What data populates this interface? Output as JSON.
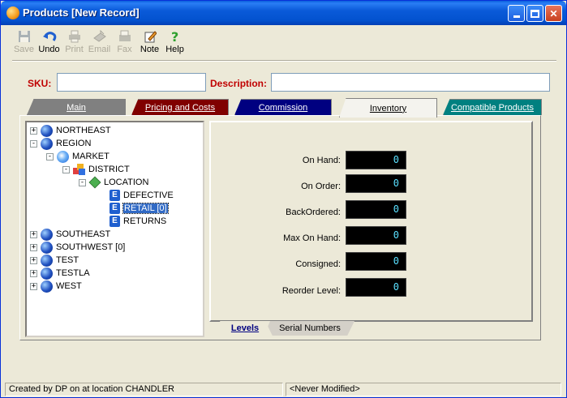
{
  "window": {
    "title": "Products [New Record]"
  },
  "toolbar": [
    {
      "label": "Save",
      "icon": "floppy-disk-icon",
      "enabled": false
    },
    {
      "label": "Undo",
      "icon": "undo-arrow-icon",
      "enabled": true
    },
    {
      "label": "Print",
      "icon": "printer-icon",
      "enabled": false
    },
    {
      "label": "Email",
      "icon": "email-icon",
      "enabled": false
    },
    {
      "label": "Fax",
      "icon": "fax-icon",
      "enabled": false
    },
    {
      "label": "Note",
      "icon": "note-pencil-icon",
      "enabled": true
    },
    {
      "label": "Help",
      "icon": "help-question-icon",
      "enabled": true
    }
  ],
  "form": {
    "sku_label": "SKU:",
    "sku_value": "",
    "description_label": "Description:",
    "description_value": ""
  },
  "tabs": [
    {
      "label": "Main",
      "color": "#808080"
    },
    {
      "label": "Pricing and Costs",
      "color": "#800000"
    },
    {
      "label": "Commission",
      "color": "#000080"
    },
    {
      "label": "Inventory",
      "color": "#f4f3ee",
      "active": true
    },
    {
      "label": "Compatible Products",
      "color": "#008080"
    }
  ],
  "tree": [
    {
      "label": "NORTHEAST",
      "expander": "+",
      "icon": "globe-icon"
    },
    {
      "label": "REGION",
      "expander": "-",
      "icon": "globe-icon"
    },
    {
      "label": "MARKET",
      "expander": "-",
      "icon": "market-globe-icon"
    },
    {
      "label": "DISTRICT",
      "expander": "-",
      "icon": "district-blocks-icon"
    },
    {
      "label": "LOCATION",
      "expander": "-",
      "icon": "location-diamond-icon"
    },
    {
      "label": "DEFECTIVE",
      "expander": "",
      "icon": "bin-icon"
    },
    {
      "label": "RETAIL [0]",
      "expander": "",
      "icon": "bin-icon",
      "selected": true
    },
    {
      "label": "RETURNS",
      "expander": "",
      "icon": "bin-icon"
    },
    {
      "label": "SOUTHEAST",
      "expander": "+",
      "icon": "globe-icon"
    },
    {
      "label": "SOUTHWEST [0]",
      "expander": "+",
      "icon": "globe-icon"
    },
    {
      "label": "TEST",
      "expander": "+",
      "icon": "globe-icon"
    },
    {
      "label": "TESTLA",
      "expander": "+",
      "icon": "globe-icon"
    },
    {
      "label": "WEST",
      "expander": "+",
      "icon": "globe-icon"
    }
  ],
  "inventory": [
    {
      "label": "On Hand:",
      "value": "0"
    },
    {
      "label": "On Order:",
      "value": "0"
    },
    {
      "label": "BackOrdered:",
      "value": "0"
    },
    {
      "label": "Max On Hand:",
      "value": "0"
    },
    {
      "label": "Consigned:",
      "value": "0"
    },
    {
      "label": "Reorder Level:",
      "value": "0"
    }
  ],
  "subtabs": [
    {
      "label": "Levels",
      "active": true
    },
    {
      "label": "Serial Numbers"
    }
  ],
  "status": {
    "left": "Created by DP on  at location CHANDLER",
    "right": "<Never Modified>"
  }
}
